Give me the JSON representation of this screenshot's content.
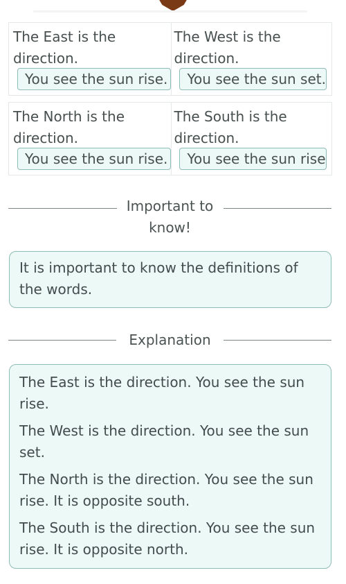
{
  "header": {
    "decoration_icon": "brown-shield-badge"
  },
  "matching": {
    "rows": [
      {
        "cells": [
          {
            "text": "The East is the direction.",
            "answer": "You see the sun rise."
          },
          {
            "text": "The West is the direction.",
            "answer": "You see the sun set."
          }
        ]
      },
      {
        "cells": [
          {
            "text": "The North is the direction.",
            "answer": "You see the sun rise."
          },
          {
            "text": "The South is the direction.",
            "answer": "You see the sun rise."
          }
        ]
      }
    ]
  },
  "important": {
    "heading": "Important to know!",
    "text": "It is important to know the definitions of the words."
  },
  "explanation": {
    "heading": "Explanation",
    "paragraphs": [
      "The East is the direction. You see the sun rise.",
      "The West is the direction. You see the sun set.",
      "The North is the direction. You see the sun rise. It is opposite south.",
      "The South is the direction. You see the sun rise. It is opposite north."
    ]
  },
  "colors": {
    "accent_border": "#8fbcb6",
    "accent_fill": "#edf9f6",
    "badge": "#7a3a16"
  }
}
